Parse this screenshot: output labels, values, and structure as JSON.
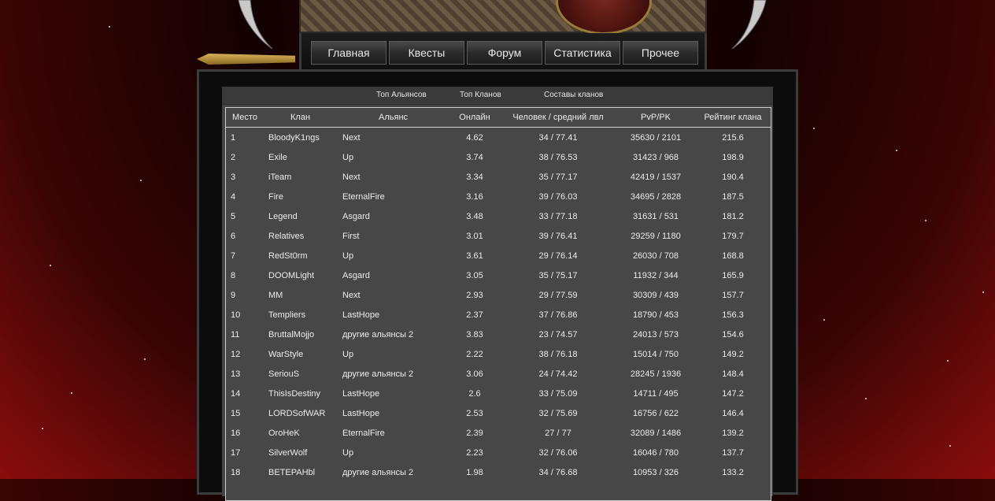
{
  "nav": [
    {
      "label": "Главная"
    },
    {
      "label": "Квесты"
    },
    {
      "label": "Форум"
    },
    {
      "label": "Статистика"
    },
    {
      "label": "Прочее"
    }
  ],
  "subnav": [
    {
      "label": "Топ Альянсов"
    },
    {
      "label": "Топ Кланов"
    },
    {
      "label": "Составы кланов"
    }
  ],
  "table": {
    "headers": {
      "place": "Место",
      "clan": "Клан",
      "alliance": "Альянс",
      "online": "Онлайн",
      "people": "Человек / средний лвл",
      "pvp": "PvP/PK",
      "rating": "Рейтинг клана"
    },
    "rows": [
      {
        "place": "1",
        "clan": "BloodyK1ngs",
        "alliance": "Next",
        "online": "4.62",
        "people": "34 / 77.41",
        "pvp": "35630 / 2101",
        "rating": "215.6"
      },
      {
        "place": "2",
        "clan": "Exile",
        "alliance": "Up",
        "online": "3.74",
        "people": "38 / 76.53",
        "pvp": "31423 / 968",
        "rating": "198.9"
      },
      {
        "place": "3",
        "clan": "iTeam",
        "alliance": "Next",
        "online": "3.34",
        "people": "35 / 77.17",
        "pvp": "42419 / 1537",
        "rating": "190.4"
      },
      {
        "place": "4",
        "clan": "Fire",
        "alliance": "EternalFire",
        "online": "3.16",
        "people": "39 / 76.03",
        "pvp": "34695 / 2828",
        "rating": "187.5"
      },
      {
        "place": "5",
        "clan": "Legend",
        "alliance": "Asgard",
        "online": "3.48",
        "people": "33 / 77.18",
        "pvp": "31631 / 531",
        "rating": "181.2"
      },
      {
        "place": "6",
        "clan": "Relatives",
        "alliance": "First",
        "online": "3.01",
        "people": "39 / 76.41",
        "pvp": "29259 / 1180",
        "rating": "179.7"
      },
      {
        "place": "7",
        "clan": "RedSt0rm",
        "alliance": "Up",
        "online": "3.61",
        "people": "29 / 76.14",
        "pvp": "26030 / 708",
        "rating": "168.8"
      },
      {
        "place": "8",
        "clan": "DOOMLight",
        "alliance": "Asgard",
        "online": "3.05",
        "people": "35 / 75.17",
        "pvp": "11932 / 344",
        "rating": "165.9"
      },
      {
        "place": "9",
        "clan": "MM",
        "alliance": "Next",
        "online": "2.93",
        "people": "29 / 77.59",
        "pvp": "30309 / 439",
        "rating": "157.7"
      },
      {
        "place": "10",
        "clan": "Templiers",
        "alliance": "LastHope",
        "online": "2.37",
        "people": "37 / 76.86",
        "pvp": "18790 / 453",
        "rating": "156.3"
      },
      {
        "place": "11",
        "clan": "BruttalMojjo",
        "alliance": "другие альянсы 2",
        "online": "3.83",
        "people": "23 / 74.57",
        "pvp": "24013 / 573",
        "rating": "154.6"
      },
      {
        "place": "12",
        "clan": "WarStyle",
        "alliance": "Up",
        "online": "2.22",
        "people": "38 / 76.18",
        "pvp": "15014 / 750",
        "rating": "149.2"
      },
      {
        "place": "13",
        "clan": "SeriouS",
        "alliance": "другие альянсы 2",
        "online": "3.06",
        "people": "24 / 74.42",
        "pvp": "28245 / 1936",
        "rating": "148.4"
      },
      {
        "place": "14",
        "clan": "ThisIsDestiny",
        "alliance": "LastHope",
        "online": "2.6",
        "people": "33 / 75.09",
        "pvp": "14711 / 495",
        "rating": "147.2"
      },
      {
        "place": "15",
        "clan": "LORDSofWAR",
        "alliance": "LastHope",
        "online": "2.53",
        "people": "32 / 75.69",
        "pvp": "16756 / 622",
        "rating": "146.4"
      },
      {
        "place": "16",
        "clan": "OroHeK",
        "alliance": "EternalFire",
        "online": "2.39",
        "people": "27 / 77",
        "pvp": "32089 / 1486",
        "rating": "139.2"
      },
      {
        "place": "17",
        "clan": "SilverWolf",
        "alliance": "Up",
        "online": "2.23",
        "people": "32 / 76.06",
        "pvp": "16046 / 780",
        "rating": "137.7"
      },
      {
        "place": "18",
        "clan": "BETEPAHbl",
        "alliance": "другие альянсы 2",
        "online": "1.98",
        "people": "34 / 76.68",
        "pvp": "10953 / 326",
        "rating": "133.2"
      }
    ]
  }
}
